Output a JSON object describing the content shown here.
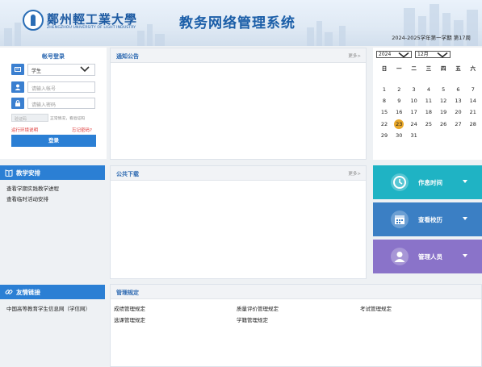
{
  "header": {
    "school_cn": "鄭州輕工業大學",
    "school_en": "ZHENGZHOU UNIVERSITY OF LIGHT INDUSTRY",
    "system_title": "教务网络管理系统",
    "term": "2024-2025学年第一学期 第17周"
  },
  "login": {
    "title": "帐号登录",
    "role": "学生",
    "account_placeholder": "请输入帐号",
    "password_placeholder": "请输入密码",
    "captcha_placeholder": "验证码",
    "captcha_refresh": "正常情况，看验证码",
    "env_link": "运行环境说明",
    "forgot_link": "忘记密码?",
    "login_button": "登录"
  },
  "notice": {
    "title": "通知公告",
    "more": "更多>"
  },
  "download": {
    "title": "公共下载",
    "more": "更多>"
  },
  "teaching": {
    "title": "教学安排",
    "links": [
      "查看学期实践教学进程",
      "查看临时活动安排"
    ]
  },
  "friend_links": {
    "title": "友情链接",
    "links": [
      "中国高等教育学生信息网（学信网）"
    ]
  },
  "regulations": {
    "title": "管理规定",
    "items": [
      "成绩管理规定",
      "质量评价管理规定",
      "考试管理规定",
      "选课管理规定",
      "学籍管理规定"
    ]
  },
  "calendar": {
    "year": "2024",
    "month": "12月",
    "weekdays": [
      "日",
      "一",
      "二",
      "三",
      "四",
      "五",
      "六"
    ],
    "weeks": [
      [
        "1",
        "2",
        "3",
        "4",
        "5",
        "6",
        "7"
      ],
      [
        "8",
        "9",
        "10",
        "11",
        "12",
        "13",
        "14"
      ],
      [
        "15",
        "16",
        "17",
        "18",
        "19",
        "20",
        "21"
      ],
      [
        "22",
        "23",
        "24",
        "25",
        "26",
        "27",
        "28"
      ],
      [
        "29",
        "30",
        "31",
        "",
        "",
        "",
        ""
      ]
    ],
    "today": "23",
    "today_color": "#e9a82a"
  },
  "tiles": [
    {
      "label": "作息时间",
      "icon": "clock-icon",
      "color": "#1fb3c4"
    },
    {
      "label": "查看校历",
      "icon": "calendar-icon",
      "color": "#3b7fc4"
    },
    {
      "label": "管理人员",
      "icon": "user-icon",
      "color": "#8a73c9"
    }
  ],
  "colors": {
    "primary": "#2b7fd4",
    "accent_title": "#2a67b0",
    "link_red": "#d33333"
  }
}
